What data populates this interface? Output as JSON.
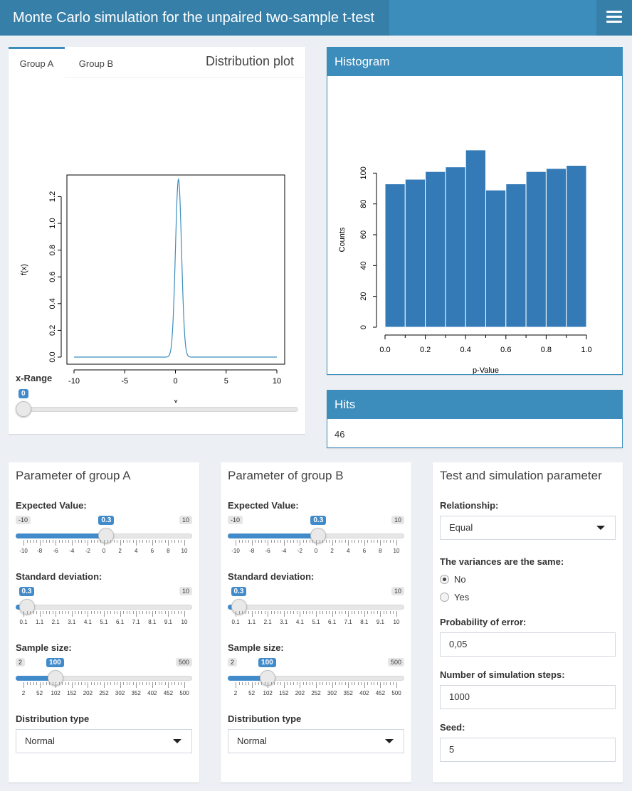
{
  "header": {
    "title": "Monte Carlo simulation for the unpaired two-sample t-test"
  },
  "dist_panel": {
    "tabs": [
      {
        "label": "Group A"
      },
      {
        "label": "Group B"
      }
    ],
    "title": "Distribution plot",
    "xrange": {
      "label": "x-Range",
      "value": "0"
    }
  },
  "hist_panel": {
    "title": "Histogram"
  },
  "hits_panel": {
    "title": "Hits",
    "value": "46"
  },
  "groupA": {
    "title": "Parameter of group A",
    "ev": {
      "label": "Expected Value:",
      "min": "-10",
      "max": "10",
      "value": "0.3",
      "ticks": [
        "-10",
        "-8",
        "-6",
        "-4",
        "-2",
        "0",
        "2",
        "4",
        "6",
        "8",
        "10"
      ]
    },
    "sd": {
      "label": "Standard deviation:",
      "max": "10",
      "value": "0.3",
      "ticks": [
        "0.1",
        "1.1",
        "2.1",
        "3.1",
        "4.1",
        "5.1",
        "6.1",
        "7.1",
        "8.1",
        "9.1",
        "10"
      ]
    },
    "n": {
      "label": "Sample size:",
      "min": "2",
      "max": "500",
      "value": "100",
      "ticks": [
        "2",
        "52",
        "102",
        "152",
        "202",
        "252",
        "302",
        "352",
        "402",
        "452",
        "500"
      ]
    },
    "dist": {
      "label": "Distribution type",
      "value": "Normal"
    }
  },
  "groupB": {
    "title": "Parameter of group B",
    "ev": {
      "label": "Expected Value:",
      "min": "-10",
      "max": "10",
      "value": "0.3",
      "ticks": [
        "-10",
        "-8",
        "-6",
        "-4",
        "-2",
        "0",
        "2",
        "4",
        "6",
        "8",
        "10"
      ]
    },
    "sd": {
      "label": "Standard deviation:",
      "max": "10",
      "value": "0.3",
      "ticks": [
        "0.1",
        "1.1",
        "2.1",
        "3.1",
        "4.1",
        "5.1",
        "6.1",
        "7.1",
        "8.1",
        "9.1",
        "10"
      ]
    },
    "n": {
      "label": "Sample size:",
      "min": "2",
      "max": "500",
      "value": "100",
      "ticks": [
        "2",
        "52",
        "102",
        "152",
        "202",
        "252",
        "302",
        "352",
        "402",
        "452",
        "500"
      ]
    },
    "dist": {
      "label": "Distribution type",
      "value": "Normal"
    }
  },
  "test": {
    "title": "Test and simulation parameter",
    "relationship": {
      "label": "Relationship:",
      "value": "Equal"
    },
    "variances": {
      "label": "The variances are the same:",
      "options": [
        "No",
        "Yes"
      ],
      "selected": "No"
    },
    "alpha": {
      "label": "Probability of error:",
      "value": "0,05"
    },
    "steps": {
      "label": "Number of simulation steps:",
      "value": "1000"
    },
    "seed": {
      "label": "Seed:",
      "value": "5"
    }
  },
  "slider_fractions": {
    "ev": 0.515,
    "sd": 0.02,
    "n": 0.197,
    "xrange": 0.0
  },
  "chart_data": [
    {
      "type": "line",
      "title": "",
      "xlabel": "x",
      "ylabel": "f(x)",
      "xlim": [
        -10,
        10
      ],
      "ylim": [
        0,
        1.33
      ],
      "xticks": [
        "-10",
        "-5",
        "0",
        "5",
        "10"
      ],
      "yticks": [
        "0.0",
        "0.2",
        "0.4",
        "0.6",
        "0.8",
        "1.0",
        "1.2"
      ],
      "series": [
        {
          "mean": 0.3,
          "sd": 0.3,
          "color": "#3c8dbc"
        }
      ]
    },
    {
      "type": "bar",
      "title": "",
      "xlabel": "p-Value",
      "ylabel": "Counts",
      "xlim": [
        0,
        1
      ],
      "ylim": [
        0,
        120
      ],
      "xticks": [
        "0.0",
        "0.2",
        "0.4",
        "0.6",
        "0.8",
        "1.0"
      ],
      "yticks": [
        "0",
        "20",
        "40",
        "60",
        "80",
        "100"
      ],
      "bin_edges": [
        0,
        0.1,
        0.2,
        0.3,
        0.4,
        0.5,
        0.6,
        0.7,
        0.8,
        0.9,
        1.0
      ],
      "values": [
        93,
        96,
        101,
        104,
        115,
        89,
        93,
        101,
        103,
        105
      ],
      "color": "#337ab7"
    }
  ]
}
